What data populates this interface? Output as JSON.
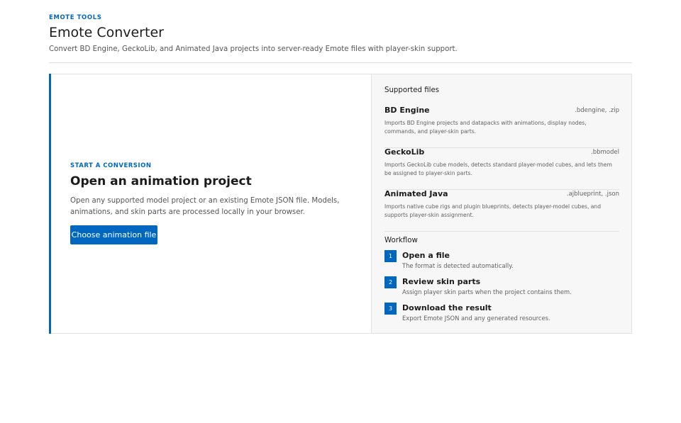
{
  "header": {
    "eyebrow": "EMOTE TOOLS",
    "title": "Emote Converter",
    "subtitle": "Convert BD Engine, GeckoLib, and Animated Java projects into server-ready Emote files with player-skin support."
  },
  "start": {
    "eyebrow": "START A CONVERSION",
    "title": "Open an animation project",
    "description": "Open any supported model project or an existing Emote JSON file. Models, animations, and skin parts are processed locally in your browser.",
    "button_label": "Choose animation file"
  },
  "supported": {
    "heading": "Supported files",
    "items": [
      {
        "name": "BD Engine",
        "extensions": ".bdengine, .zip",
        "description": "Imports BD Engine projects and datapacks with animations, display nodes, commands, and player-skin parts."
      },
      {
        "name": "GeckoLib",
        "extensions": ".bbmodel",
        "description": "Imports GeckoLib cube models, detects standard player-model cubes, and lets them be assigned to player-skin parts."
      },
      {
        "name": "Animated Java",
        "extensions": ".ajblueprint, .json",
        "description": "Imports native cube rigs and plugin blueprints, detects player-model cubes, and supports player-skin assignment."
      }
    ]
  },
  "workflow": {
    "heading": "Workflow",
    "steps": [
      {
        "number": "1",
        "title": "Open a file",
        "description": "The format is detected automatically."
      },
      {
        "number": "2",
        "title": "Review skin parts",
        "description": "Assign player skin parts when the project contains them."
      },
      {
        "number": "3",
        "title": "Download the result",
        "description": "Export Emote JSON and any generated resources."
      }
    ]
  },
  "colors": {
    "accent": "#0067c0",
    "panel_background": "#f7f7f7",
    "border": "#e1e1e1"
  }
}
